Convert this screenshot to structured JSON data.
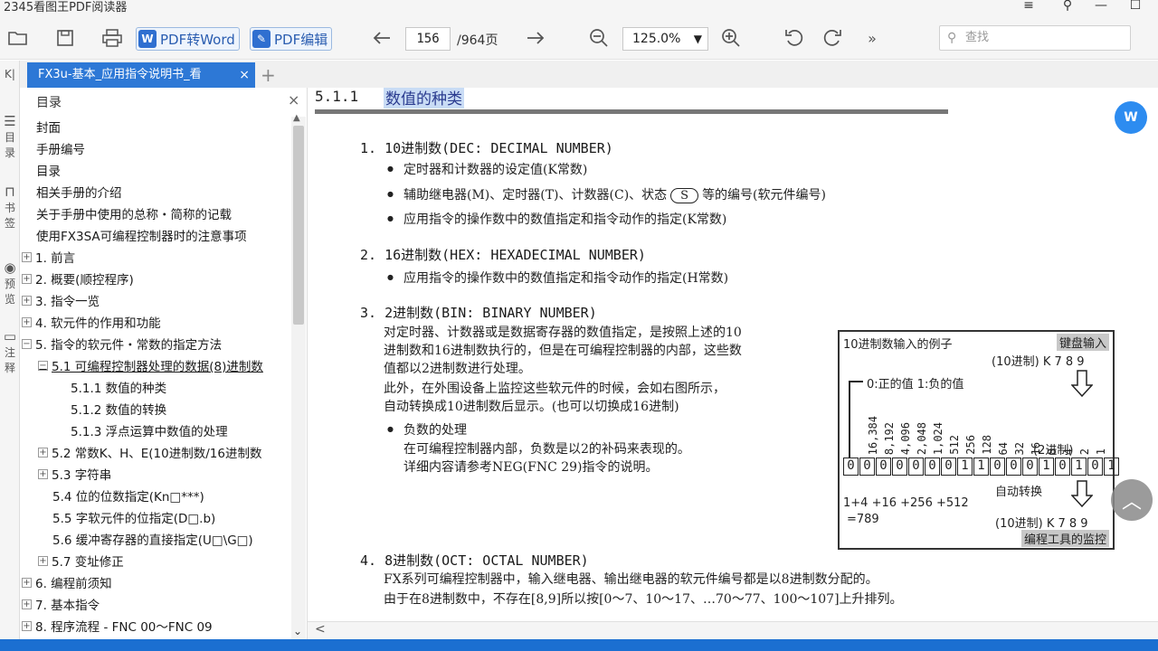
{
  "window": {
    "title": "2345看图王PDF阅读器",
    "controls": [
      "≡",
      "⚲",
      "—",
      "☐"
    ]
  },
  "toolbar": {
    "pdf_to_word": "PDF转Word",
    "pdf_edit": "PDF编辑",
    "page_current": "156",
    "page_total": "/964页",
    "zoom": "125.0%",
    "more": "»",
    "search_placeholder": "查找"
  },
  "tab": {
    "title": "FX3u-基本_应用指令说明书_看",
    "close": "×",
    "add": "+"
  },
  "leftstrip": {
    "collapse": "K|",
    "items": [
      {
        "glyph": "☰",
        "label": "目录"
      },
      {
        "glyph": "⊓",
        "label": "书签"
      },
      {
        "glyph": "◉",
        "label": "预览"
      },
      {
        "glyph": "▭",
        "label": "注释"
      }
    ]
  },
  "sidebar": {
    "header": "目录",
    "close": "×",
    "tree": [
      {
        "label": "封面",
        "level": 0,
        "expander": ""
      },
      {
        "label": "手册编号",
        "level": 0,
        "expander": ""
      },
      {
        "label": "目录",
        "level": 0,
        "expander": ""
      },
      {
        "label": "相关手册的介绍",
        "level": 0,
        "expander": ""
      },
      {
        "label": "关于手册中使用的总称・简称的记载",
        "level": 0,
        "expander": ""
      },
      {
        "label": "使用FX3SA可编程控制器时的注意事项",
        "level": 0,
        "expander": ""
      },
      {
        "label": "1. 前言",
        "level": 0,
        "expander": "+"
      },
      {
        "label": "2. 概要(顺控程序)",
        "level": 0,
        "expander": "+"
      },
      {
        "label": "3. 指令一览",
        "level": 0,
        "expander": "+"
      },
      {
        "label": "4. 软元件的作用和功能",
        "level": 0,
        "expander": "+"
      },
      {
        "label": "5. 指令的软元件・常数的指定方法",
        "level": 0,
        "expander": "−"
      },
      {
        "label": "5.1 可编程控制器处理的数据(8)进制数",
        "level": 1,
        "expander": "−",
        "selected": true
      },
      {
        "label": "5.1.1 数值的种类",
        "level": 2,
        "expander": ""
      },
      {
        "label": "5.1.2 数值的转换",
        "level": 2,
        "expander": ""
      },
      {
        "label": "5.1.3 浮点运算中数值的处理",
        "level": 2,
        "expander": ""
      },
      {
        "label": "5.2 常数K、H、E(10进制数/16进制数",
        "level": 1,
        "expander": "+"
      },
      {
        "label": "5.3 字符串",
        "level": 1,
        "expander": "+"
      },
      {
        "label": "5.4 位的位数指定(Kn□***)",
        "level": 1,
        "expander": ""
      },
      {
        "label": "5.5 字软元件的位指定(D□.b)",
        "level": 1,
        "expander": ""
      },
      {
        "label": "5.6 缓冲寄存器的直接指定(U□\\G□)",
        "level": 1,
        "expander": ""
      },
      {
        "label": "5.7 变址修正",
        "level": 1,
        "expander": "+"
      },
      {
        "label": "6. 编程前须知",
        "level": 0,
        "expander": "+"
      },
      {
        "label": "7. 基本指令",
        "level": 0,
        "expander": "+"
      },
      {
        "label": "8. 程序流程 - FNC 00～FNC 09",
        "level": 0,
        "expander": "+"
      }
    ]
  },
  "doc": {
    "section_num": "5.1.1",
    "section_title": "数值的种类",
    "s1": {
      "title": "1. 10进制数(DEC: DECIMAL NUMBER)",
      "b1": "定时器和计数器的设定值(K常数)",
      "b2_pre": "辅助继电器(M)、定时器(T)、计数器(C)、状态",
      "b2_s": "S",
      "b2_post": "等的编号(软元件编号)",
      "b3": "应用指令的操作数中的数值指定和指令动作的指定(K常数)"
    },
    "s2": {
      "title": "2. 16进制数(HEX: HEXADECIMAL NUMBER)",
      "b1": "应用指令的操作数中的数值指定和指令动作的指定(H常数)"
    },
    "s3": {
      "title": "3. 2进制数(BIN: BINARY NUMBER)",
      "p1": "对定时器、计数器或是数据寄存器的数值指定，是按照上述的10",
      "p2": "进制数和16进制数执行的，但是在可编程控制器的内部，这些数",
      "p3": "值都以2进制数进行处理。",
      "p4": "此外，在外围设备上监控这些软元件的时候，会如右图所示，",
      "p5": "自动转换成10进制数后显示。(也可以切换成16进制)",
      "b1": "负数的处理",
      "p6": "在可编程控制器内部，负数是以2的补码来表现的。",
      "p7": "详细内容请参考NEG(FNC 29)指令的说明。"
    },
    "s4": {
      "title": "4. 8进制数(OCT: OCTAL NUMBER)",
      "p1": "FX系列可编程控制器中，输入继电器、输出继电器的软元件编号都是以8进制数分配的。",
      "p2": "由于在8进制数中，不存在[8,9]所以按[0～7、10～17、…70～77、100～107]上升排列。"
    },
    "figure": {
      "title": "10进制数输入的例子",
      "keyboard": "键盘输入",
      "kdec_top": "(10进制) K  7  8  9",
      "posneg": "0:正的值   1:负的值",
      "weights": [
        "16,384",
        "8,192",
        "4,096",
        "2,048",
        "1,024",
        "512",
        "256",
        "128",
        "64",
        "32",
        "16",
        "8",
        "4",
        "2",
        "1"
      ],
      "bin_label": "(2进制)",
      "bits": [
        "0",
        "0",
        "0",
        "0",
        "0",
        "0",
        "0",
        "1",
        "1",
        "0",
        "0",
        "0",
        "1",
        "0",
        "1",
        "0",
        "1"
      ],
      "auto": "自动转换",
      "sum1": "1+4 +16 +256 +512",
      "sum2": "=789",
      "kdec_bottom": "(10进制) K  7  8  9",
      "monitor": "编程工具的监控"
    }
  },
  "floating": {
    "w_badge": "W",
    "to_top": "︿"
  },
  "hscroll": {
    "left": "<"
  }
}
